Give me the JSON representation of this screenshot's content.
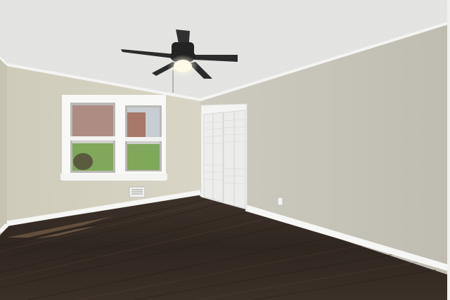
{
  "scene": {
    "subject": "empty-room-interior",
    "colors": {
      "ceiling": "#e6e6e4",
      "wall_left": "#d6d3c4",
      "wall_back": "#d8d5c6",
      "wall_right": "#c9c6ba",
      "trim": "#f7f7f5",
      "floor_dark": "#2e2620",
      "floor_mid": "#463a31",
      "fan_blade": "#2b2b2b",
      "light_glow": "#fffbe8",
      "window_lawn": "#7fa85a",
      "window_building": "#9c5a45"
    },
    "icons": [
      "ceiling-fan-icon",
      "window-icon",
      "closet-door-icon",
      "vent-icon",
      "outlet-icon"
    ]
  }
}
